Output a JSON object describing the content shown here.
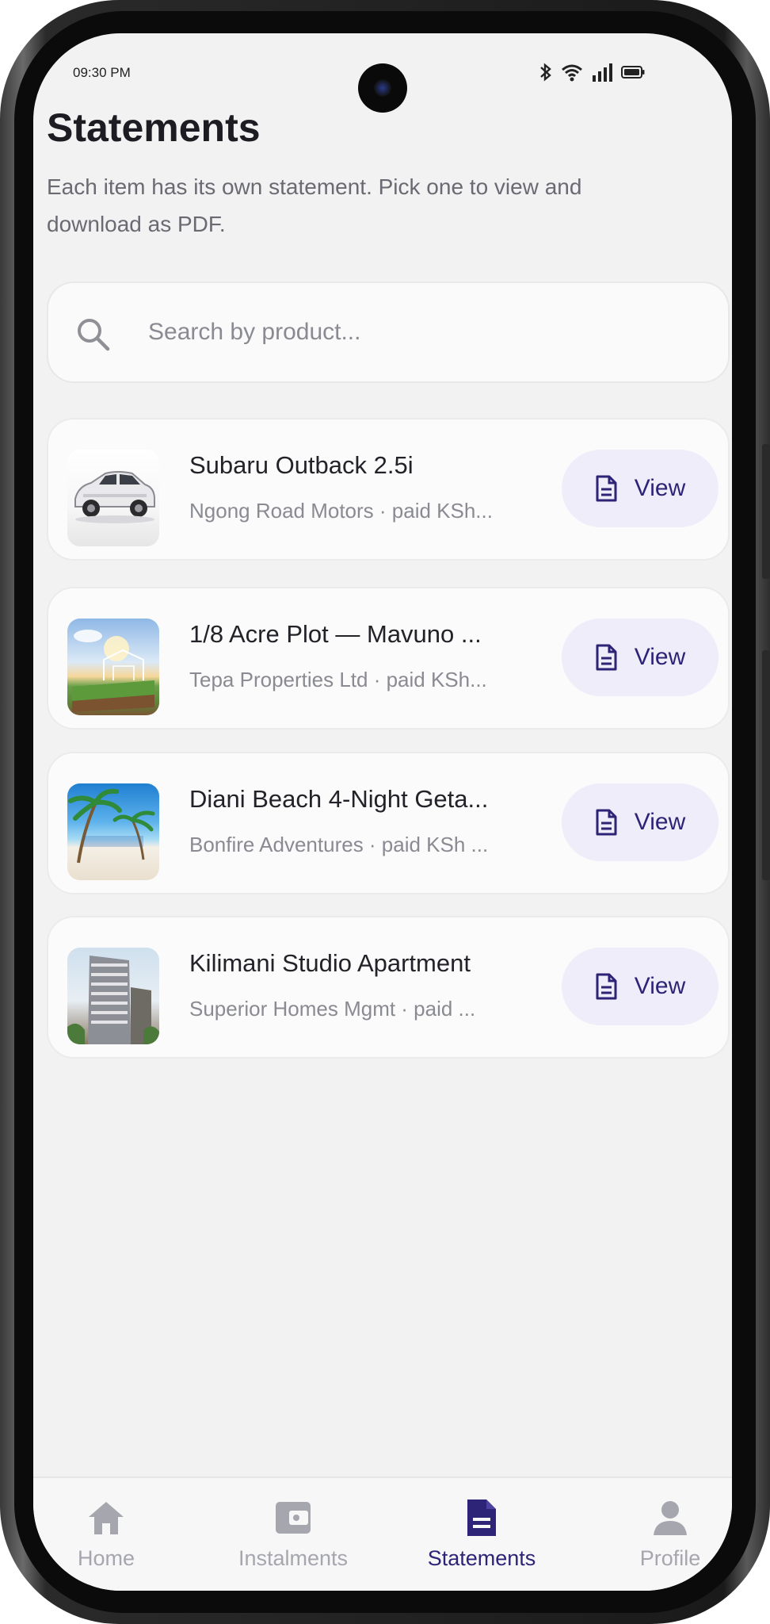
{
  "status_bar": {
    "time": "09:30 PM"
  },
  "header": {
    "title": "Statements",
    "subtitle": "Each item has its own statement. Pick one to view and download as PDF."
  },
  "search": {
    "placeholder": "Search by product...",
    "value": ""
  },
  "items": [
    {
      "title": "Subaru Outback 2.5i",
      "meta": "Ngong Road Motors · paid KSh...",
      "action": "View",
      "thumb": "car-photo"
    },
    {
      "title": "1/8 Acre Plot — Mavuno ...",
      "meta": "Tepa Properties Ltd · paid KSh...",
      "action": "View",
      "thumb": "plot-photo"
    },
    {
      "title": "Diani Beach 4-Night Geta...",
      "meta": "Bonfire Adventures · paid KSh ...",
      "action": "View",
      "thumb": "beach-photo"
    },
    {
      "title": "Kilimani Studio Apartment",
      "meta": "Superior Homes Mgmt · paid ...",
      "action": "View",
      "thumb": "apartment-photo"
    }
  ],
  "bottom_nav": [
    {
      "label": "Home",
      "icon": "home-icon",
      "active": false
    },
    {
      "label": "Instalments",
      "icon": "wallet-icon",
      "active": false
    },
    {
      "label": "Statements",
      "icon": "document-icon",
      "active": true
    },
    {
      "label": "Profile",
      "icon": "person-icon",
      "active": false
    }
  ],
  "colors": {
    "accent": "#2d2478",
    "accent_bg": "#efedf9",
    "inactive": "#a6a6ae",
    "background": "#f2f2f3"
  }
}
